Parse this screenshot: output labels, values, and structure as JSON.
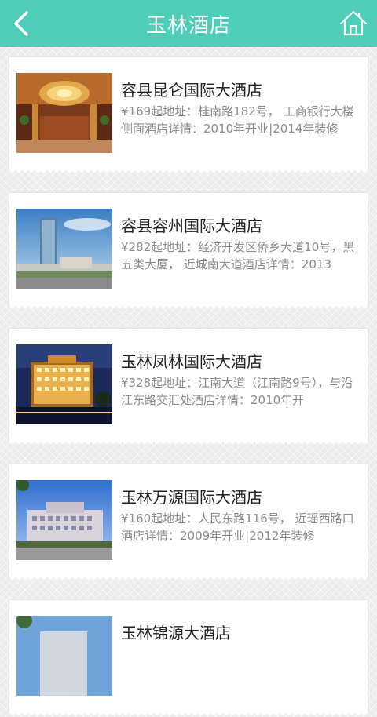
{
  "header": {
    "title": "玉林酒店",
    "back_icon": "chevron-left-icon",
    "home_icon": "home-icon",
    "bg_color": "#4ecdb8"
  },
  "hotels": [
    {
      "name": "容县昆仑国际大酒店",
      "desc": "¥169起地址：桂南路182号， 工商银行大楼侧面酒店详情：2010年开业|2014年装修"
    },
    {
      "name": "容县容州国际大酒店",
      "desc": "¥282起地址：经济开发区侨乡大道10号，黑五类大厦， 近城南大道酒店详情：2013"
    },
    {
      "name": "玉林凤林国际大酒店",
      "desc": "¥328起地址：江南大道（江南路9号），与沿江东路交汇处酒店详情：2010年开"
    },
    {
      "name": "玉林万源国际大酒店",
      "desc": "¥160起地址：人民东路116号， 近瑶西路口酒店详情：2009年开业|2012年装修"
    },
    {
      "name": "玉林锦源大酒店",
      "desc": ""
    }
  ]
}
